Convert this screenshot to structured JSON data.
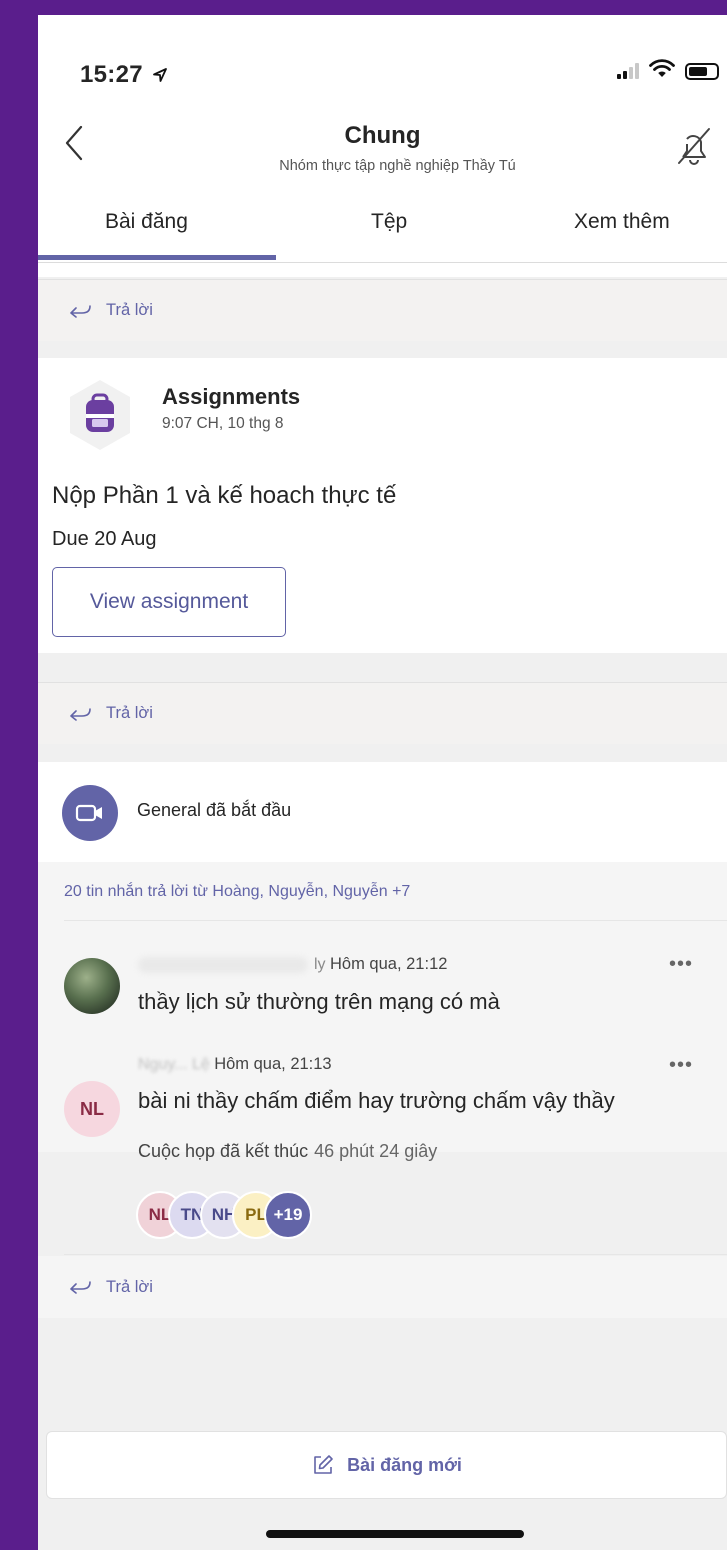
{
  "status_bar": {
    "time": "15:27"
  },
  "header": {
    "title": "Chung",
    "subtitle": "Nhóm thực tập nghề nghiệp Thầy Tú"
  },
  "tabs": [
    {
      "label": "Bài đăng",
      "active": true
    },
    {
      "label": "Tệp",
      "active": false
    },
    {
      "label": "Xem thêm",
      "active": false
    }
  ],
  "reply_label": "Trả lời",
  "assignment_post": {
    "app_name": "Assignments",
    "time": "9:07 CH, 10 thg 8",
    "title": "Nộp Phần 1 và kế hoach thực tế",
    "due": "Due 20 Aug",
    "button_label": "View assignment"
  },
  "meeting_post": {
    "title": "General đã bắt đầu",
    "replies_summary": "20 tin nhắn trả lời từ Hoàng, Nguyễn, Nguyễn +7",
    "messages": [
      {
        "author_fragment": "ly",
        "time": "Hôm qua, 21:12",
        "text": "thầy lịch sử thường trên mạng có mà",
        "avatar": "photo"
      },
      {
        "author_fragment": "Nguy... Lệ",
        "time": "Hôm qua, 21:13",
        "text": "bài ni thầy chấm điểm hay trường chấm vậy thầy",
        "avatar": "NL"
      }
    ],
    "ended_label": "Cuộc họp đã kết thúc",
    "duration": "46 phút 24 giây",
    "participants": [
      {
        "initials": "NL",
        "bg": "#f0d2d8",
        "fg": "#8a2b45"
      },
      {
        "initials": "TN",
        "bg": "#dcdaf0",
        "fg": "#4a4a8a"
      },
      {
        "initials": "NH",
        "bg": "#e3e1f0",
        "fg": "#4a4a8a"
      },
      {
        "initials": "PL",
        "bg": "#fbf0c4",
        "fg": "#8a6a10"
      }
    ],
    "more_participants": "+19"
  },
  "new_post_label": "Bài đăng mới",
  "colors": {
    "accent": "#6264a7",
    "frame": "#5a1e8c"
  }
}
